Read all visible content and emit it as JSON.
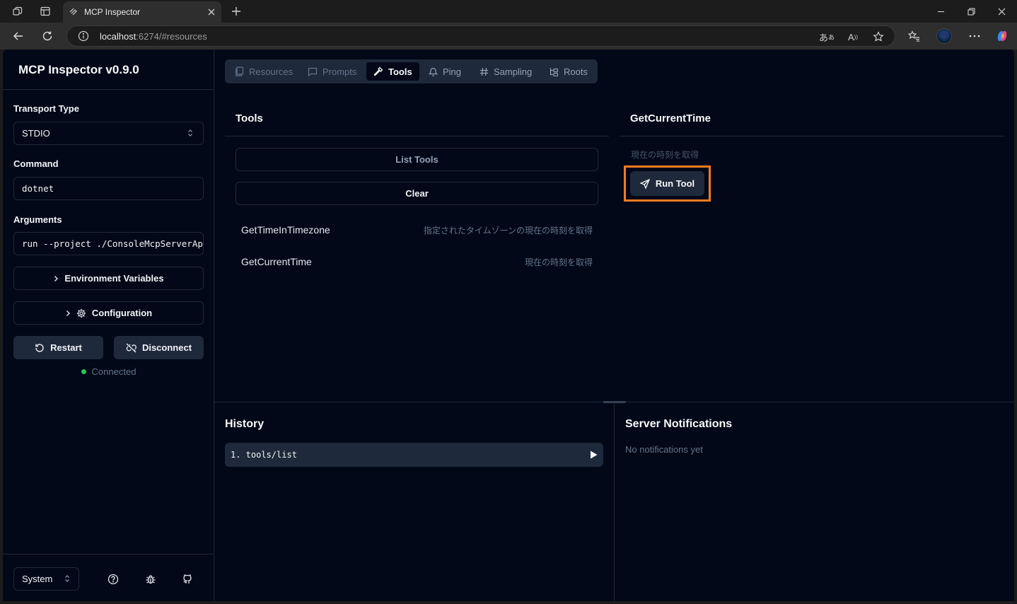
{
  "browser": {
    "tab_title": "MCP Inspector",
    "url_host": "localhost",
    "url_rest": ":6274/#resources",
    "translate_glyph": "あ",
    "read_aloud_glyph": "A"
  },
  "sidebar": {
    "title": "MCP Inspector v0.9.0",
    "transport_label": "Transport Type",
    "transport_value": "STDIO",
    "command_label": "Command",
    "command_value": "dotnet",
    "arguments_label": "Arguments",
    "arguments_value": "run --project ./ConsoleMcpServerAp",
    "env_label": "Environment Variables",
    "config_label": "Configuration",
    "restart_label": "Restart",
    "disconnect_label": "Disconnect",
    "status_text": "Connected",
    "theme_value": "System"
  },
  "tabs": [
    {
      "label": "Resources"
    },
    {
      "label": "Prompts"
    },
    {
      "label": "Tools"
    },
    {
      "label": "Ping"
    },
    {
      "label": "Sampling"
    },
    {
      "label": "Roots"
    }
  ],
  "tools_panel": {
    "title": "Tools",
    "list_label": "List Tools",
    "clear_label": "Clear",
    "items": [
      {
        "name": "GetTimeInTimezone",
        "description": "指定されたタイムゾーンの現在の時刻を取得"
      },
      {
        "name": "GetCurrentTime",
        "description": "現在の時刻を取得"
      }
    ]
  },
  "detail_panel": {
    "title": "GetCurrentTime",
    "description": "現在の時刻を取得",
    "run_label": "Run Tool"
  },
  "history": {
    "title": "History",
    "items": [
      {
        "text": "1. tools/list"
      }
    ]
  },
  "notifications": {
    "title": "Server Notifications",
    "empty_text": "No notifications yet"
  },
  "colors": {
    "app_bg": "#020817",
    "border": "#1e293b",
    "highlight": "#f57c1f",
    "connected": "#22c55e"
  }
}
